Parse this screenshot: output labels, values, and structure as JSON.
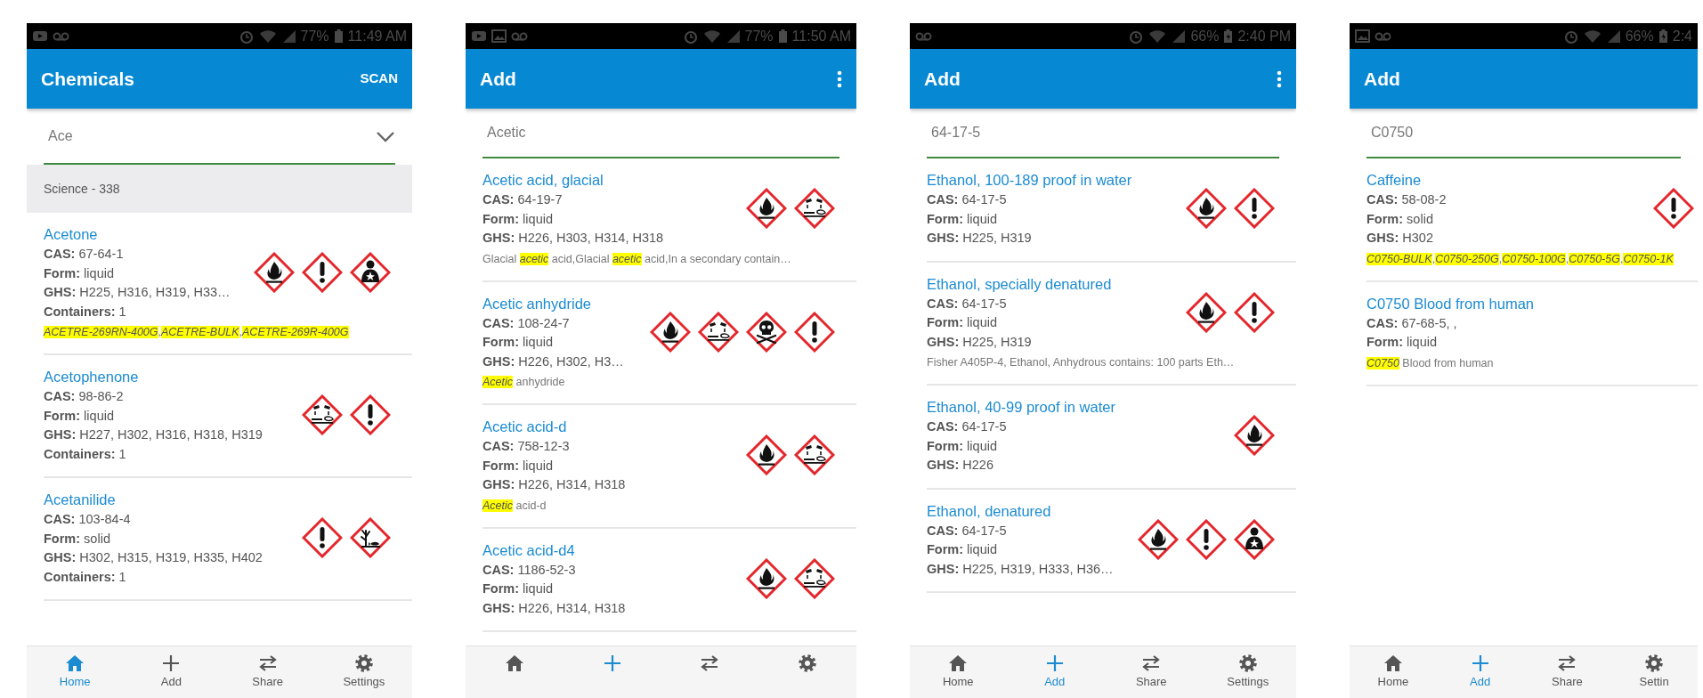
{
  "screens": [
    {
      "status_bar": {
        "left_icons": [
          {
            "kind": "video"
          },
          {
            "kind": "voicemail"
          }
        ],
        "battery": "77%",
        "charging": false,
        "time": "11:49 AM"
      },
      "app_bar": {
        "title": "Chemicals",
        "action": {
          "kind": "text",
          "label": "SCAN"
        }
      },
      "search": {
        "value": "Ace",
        "dropdown": true
      },
      "section_header": "Science - 338",
      "items": [
        {
          "name": "Acetone",
          "fields": [
            {
              "label": "CAS:",
              "value": "67-64-1"
            },
            {
              "label": "Form:",
              "value": "liquid"
            },
            {
              "label": "GHS:",
              "value": "H225, H316, H319, H33…"
            },
            {
              "label": "Containers:",
              "value": "1"
            }
          ],
          "notes": [
            {
              "text": "ACETRE-269RN-400G",
              "highlight": true
            },
            {
              "text": ",",
              "highlight": false
            },
            {
              "text": "ACETRE-BULK",
              "highlight": true
            },
            {
              "text": ",",
              "highlight": false
            },
            {
              "text": "ACETRE-269R-400G",
              "highlight": true
            }
          ],
          "pictograms": [
            {
              "kind": "flame"
            },
            {
              "kind": "exclamation"
            },
            {
              "kind": "health"
            }
          ]
        },
        {
          "name": "Acetophenone",
          "fields": [
            {
              "label": "CAS:",
              "value": "98-86-2"
            },
            {
              "label": "Form:",
              "value": "liquid"
            },
            {
              "label": "GHS:",
              "value": "H227, H302, H316, H318, H319"
            },
            {
              "label": "Containers:",
              "value": "1"
            }
          ],
          "pictograms": [
            {
              "kind": "corrosion"
            },
            {
              "kind": "exclamation"
            }
          ]
        },
        {
          "name": "Acetanilide",
          "fields": [
            {
              "label": "CAS:",
              "value": "103-84-4"
            },
            {
              "label": "Form:",
              "value": "solid"
            },
            {
              "label": "GHS:",
              "value": "H302, H315, H319, H335, H402"
            },
            {
              "label": "Containers:",
              "value": "1"
            }
          ],
          "pictograms": [
            {
              "kind": "exclamation"
            },
            {
              "kind": "environment"
            }
          ]
        }
      ],
      "nav": [
        {
          "kind": "home",
          "label": "Home",
          "selected": true
        },
        {
          "kind": "add",
          "label": "Add",
          "selected": false
        },
        {
          "kind": "share",
          "label": "Share",
          "selected": false
        },
        {
          "kind": "settings",
          "label": "Settings",
          "selected": false
        }
      ]
    },
    {
      "status_bar": {
        "left_icons": [
          {
            "kind": "video"
          },
          {
            "kind": "image"
          },
          {
            "kind": "voicemail"
          }
        ],
        "battery": "77%",
        "charging": false,
        "time": "11:50 AM"
      },
      "app_bar": {
        "title": "Add",
        "action": {
          "kind": "menu"
        }
      },
      "search": {
        "value": "Acetic",
        "dropdown": false
      },
      "items": [
        {
          "name": "Acetic acid, glacial",
          "fields": [
            {
              "label": "CAS:",
              "value": "64-19-7"
            },
            {
              "label": "Form:",
              "value": "liquid"
            },
            {
              "label": "GHS:",
              "value": "H226, H303, H314, H318"
            }
          ],
          "notes": [
            {
              "text": "Glacial ",
              "highlight": false
            },
            {
              "text": "acetic",
              "highlight": true
            },
            {
              "text": " acid,Glacial ",
              "highlight": false
            },
            {
              "text": "acetic",
              "highlight": true
            },
            {
              "text": " acid,In a secondary contain…",
              "highlight": false
            }
          ],
          "pictograms": [
            {
              "kind": "flame"
            },
            {
              "kind": "corrosion"
            }
          ]
        },
        {
          "name": "Acetic anhydride",
          "fields": [
            {
              "label": "CAS:",
              "value": "108-24-7"
            },
            {
              "label": "Form:",
              "value": "liquid"
            },
            {
              "label": "GHS:",
              "value": "H226, H302, H3…"
            }
          ],
          "notes": [
            {
              "text": "Acetic",
              "highlight": true
            },
            {
              "text": " anhydride",
              "highlight": false
            }
          ],
          "pictograms": [
            {
              "kind": "flame"
            },
            {
              "kind": "corrosion"
            },
            {
              "kind": "skull"
            },
            {
              "kind": "exclamation"
            }
          ]
        },
        {
          "name": "Acetic acid-d",
          "fields": [
            {
              "label": "CAS:",
              "value": "758-12-3"
            },
            {
              "label": "Form:",
              "value": "liquid"
            },
            {
              "label": "GHS:",
              "value": "H226, H314, H318"
            }
          ],
          "notes": [
            {
              "text": "Acetic",
              "highlight": true
            },
            {
              "text": " acid-d",
              "highlight": false
            }
          ],
          "pictograms": [
            {
              "kind": "flame"
            },
            {
              "kind": "corrosion"
            }
          ]
        },
        {
          "name": "Acetic acid-d4",
          "fields": [
            {
              "label": "CAS:",
              "value": "1186-52-3"
            },
            {
              "label": "Form:",
              "value": "liquid"
            },
            {
              "label": "GHS:",
              "value": "H226, H314, H318"
            }
          ],
          "pictograms": [
            {
              "kind": "flame"
            },
            {
              "kind": "corrosion"
            }
          ]
        }
      ],
      "nav": [
        {
          "kind": "home",
          "selected": false
        },
        {
          "kind": "add",
          "selected": true
        },
        {
          "kind": "share",
          "selected": false
        },
        {
          "kind": "settings",
          "selected": false
        }
      ]
    },
    {
      "status_bar": {
        "left_icons": [
          {
            "kind": "voicemail"
          }
        ],
        "battery": "66%",
        "charging": true,
        "time": "2:40 PM"
      },
      "app_bar": {
        "title": "Add",
        "action": {
          "kind": "menu"
        }
      },
      "search": {
        "value": "64-17-5",
        "dropdown": false
      },
      "items": [
        {
          "name": "Ethanol, 100-189 proof in water",
          "fields": [
            {
              "label": "CAS:",
              "value": "64-17-5"
            },
            {
              "label": "Form:",
              "value": "liquid"
            },
            {
              "label": "GHS:",
              "value": "H225, H319"
            }
          ],
          "pictograms": [
            {
              "kind": "flame"
            },
            {
              "kind": "exclamation"
            }
          ]
        },
        {
          "name": "Ethanol, specially denatured",
          "fields": [
            {
              "label": "CAS:",
              "value": "64-17-5"
            },
            {
              "label": "Form:",
              "value": "liquid"
            },
            {
              "label": "GHS:",
              "value": "H225, H319"
            }
          ],
          "notes": [
            {
              "text": "Fisher A405P-4, Ethanol, Anhydrous contains: 100 parts Eth…",
              "highlight": false
            }
          ],
          "pictograms": [
            {
              "kind": "flame"
            },
            {
              "kind": "exclamation"
            }
          ]
        },
        {
          "name": "Ethanol, 40-99 proof in water",
          "fields": [
            {
              "label": "CAS:",
              "value": "64-17-5"
            },
            {
              "label": "Form:",
              "value": "liquid"
            },
            {
              "label": "GHS:",
              "value": "H226"
            }
          ],
          "pictograms": [
            {
              "kind": "flame"
            }
          ]
        },
        {
          "name": "Ethanol, denatured",
          "fields": [
            {
              "label": "CAS:",
              "value": "64-17-5"
            },
            {
              "label": "Form:",
              "value": "liquid"
            },
            {
              "label": "GHS:",
              "value": "H225, H319, H333, H36…"
            }
          ],
          "pictograms": [
            {
              "kind": "flame"
            },
            {
              "kind": "exclamation"
            },
            {
              "kind": "health"
            }
          ]
        }
      ],
      "nav": [
        {
          "kind": "home",
          "label": "Home",
          "selected": false
        },
        {
          "kind": "add",
          "label": "Add",
          "selected": true
        },
        {
          "kind": "share",
          "label": "Share",
          "selected": false
        },
        {
          "kind": "settings",
          "label": "Settings",
          "selected": false
        }
      ]
    },
    {
      "status_bar": {
        "left_icons": [
          {
            "kind": "image"
          },
          {
            "kind": "voicemail"
          }
        ],
        "battery": "66%",
        "charging": true,
        "time": "2:4"
      },
      "app_bar": {
        "title": "Add"
      },
      "search": {
        "value": "C0750",
        "dropdown": false
      },
      "items": [
        {
          "name": "Caffeine",
          "fields": [
            {
              "label": "CAS:",
              "value": "58-08-2"
            },
            {
              "label": "Form:",
              "value": "solid"
            },
            {
              "label": "GHS:",
              "value": "H302"
            }
          ],
          "notes": [
            {
              "text": "C0750-BULK",
              "highlight": true
            },
            {
              "text": ",",
              "highlight": false
            },
            {
              "text": "C0750-250G",
              "highlight": true
            },
            {
              "text": ",",
              "highlight": false
            },
            {
              "text": "C0750-100G",
              "highlight": true
            },
            {
              "text": ",",
              "highlight": false
            },
            {
              "text": "C0750-5G",
              "highlight": true
            },
            {
              "text": ",",
              "highlight": false
            },
            {
              "text": "C0750-1K",
              "highlight": true
            }
          ],
          "pictograms": [
            {
              "kind": "exclamation"
            }
          ]
        },
        {
          "name": "C0750 Blood from human",
          "fields": [
            {
              "label": "CAS:",
              "value": "67-68-5, ,"
            },
            {
              "label": "Form:",
              "value": "liquid"
            }
          ],
          "notes": [
            {
              "text": "C0750",
              "highlight": true
            },
            {
              "text": " Blood from human",
              "highlight": false
            }
          ]
        }
      ],
      "nav": [
        {
          "kind": "home",
          "label": "Home",
          "selected": false
        },
        {
          "kind": "add",
          "label": "Add",
          "selected": true
        },
        {
          "kind": "share",
          "label": "Share",
          "selected": false
        },
        {
          "kind": "settings",
          "label": "Settin",
          "selected": false
        }
      ]
    }
  ]
}
